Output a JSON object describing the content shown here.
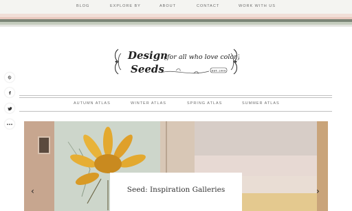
{
  "top_nav": {
    "items": [
      "BLOG",
      "EXPLORE BY",
      "ABOUT",
      "CONTACT",
      "WORK WITH US"
    ]
  },
  "logo": {
    "line1": "Design",
    "line2": "Seeds",
    "tagline": "{for all who love color}",
    "est": "EST. 2009"
  },
  "social": {
    "icons": [
      "pinterest-icon",
      "facebook-icon",
      "twitter-icon",
      "more-icon"
    ]
  },
  "secondary_nav": {
    "items": [
      "AUTUMN ATLAS",
      "WINTER ATLAS",
      "SPRING ATLAS",
      "SUMMER ATLAS"
    ]
  },
  "hero": {
    "caption": "Seed: Inspiration Galleries",
    "prev_arrow": "‹",
    "next_arrow": "›"
  },
  "colors": {
    "stripe_dark": "#7c8677",
    "stripe_pink": "#e9c9bf",
    "stripe_sage": "#c4ccbd",
    "sunflower": "#e3a92f"
  }
}
